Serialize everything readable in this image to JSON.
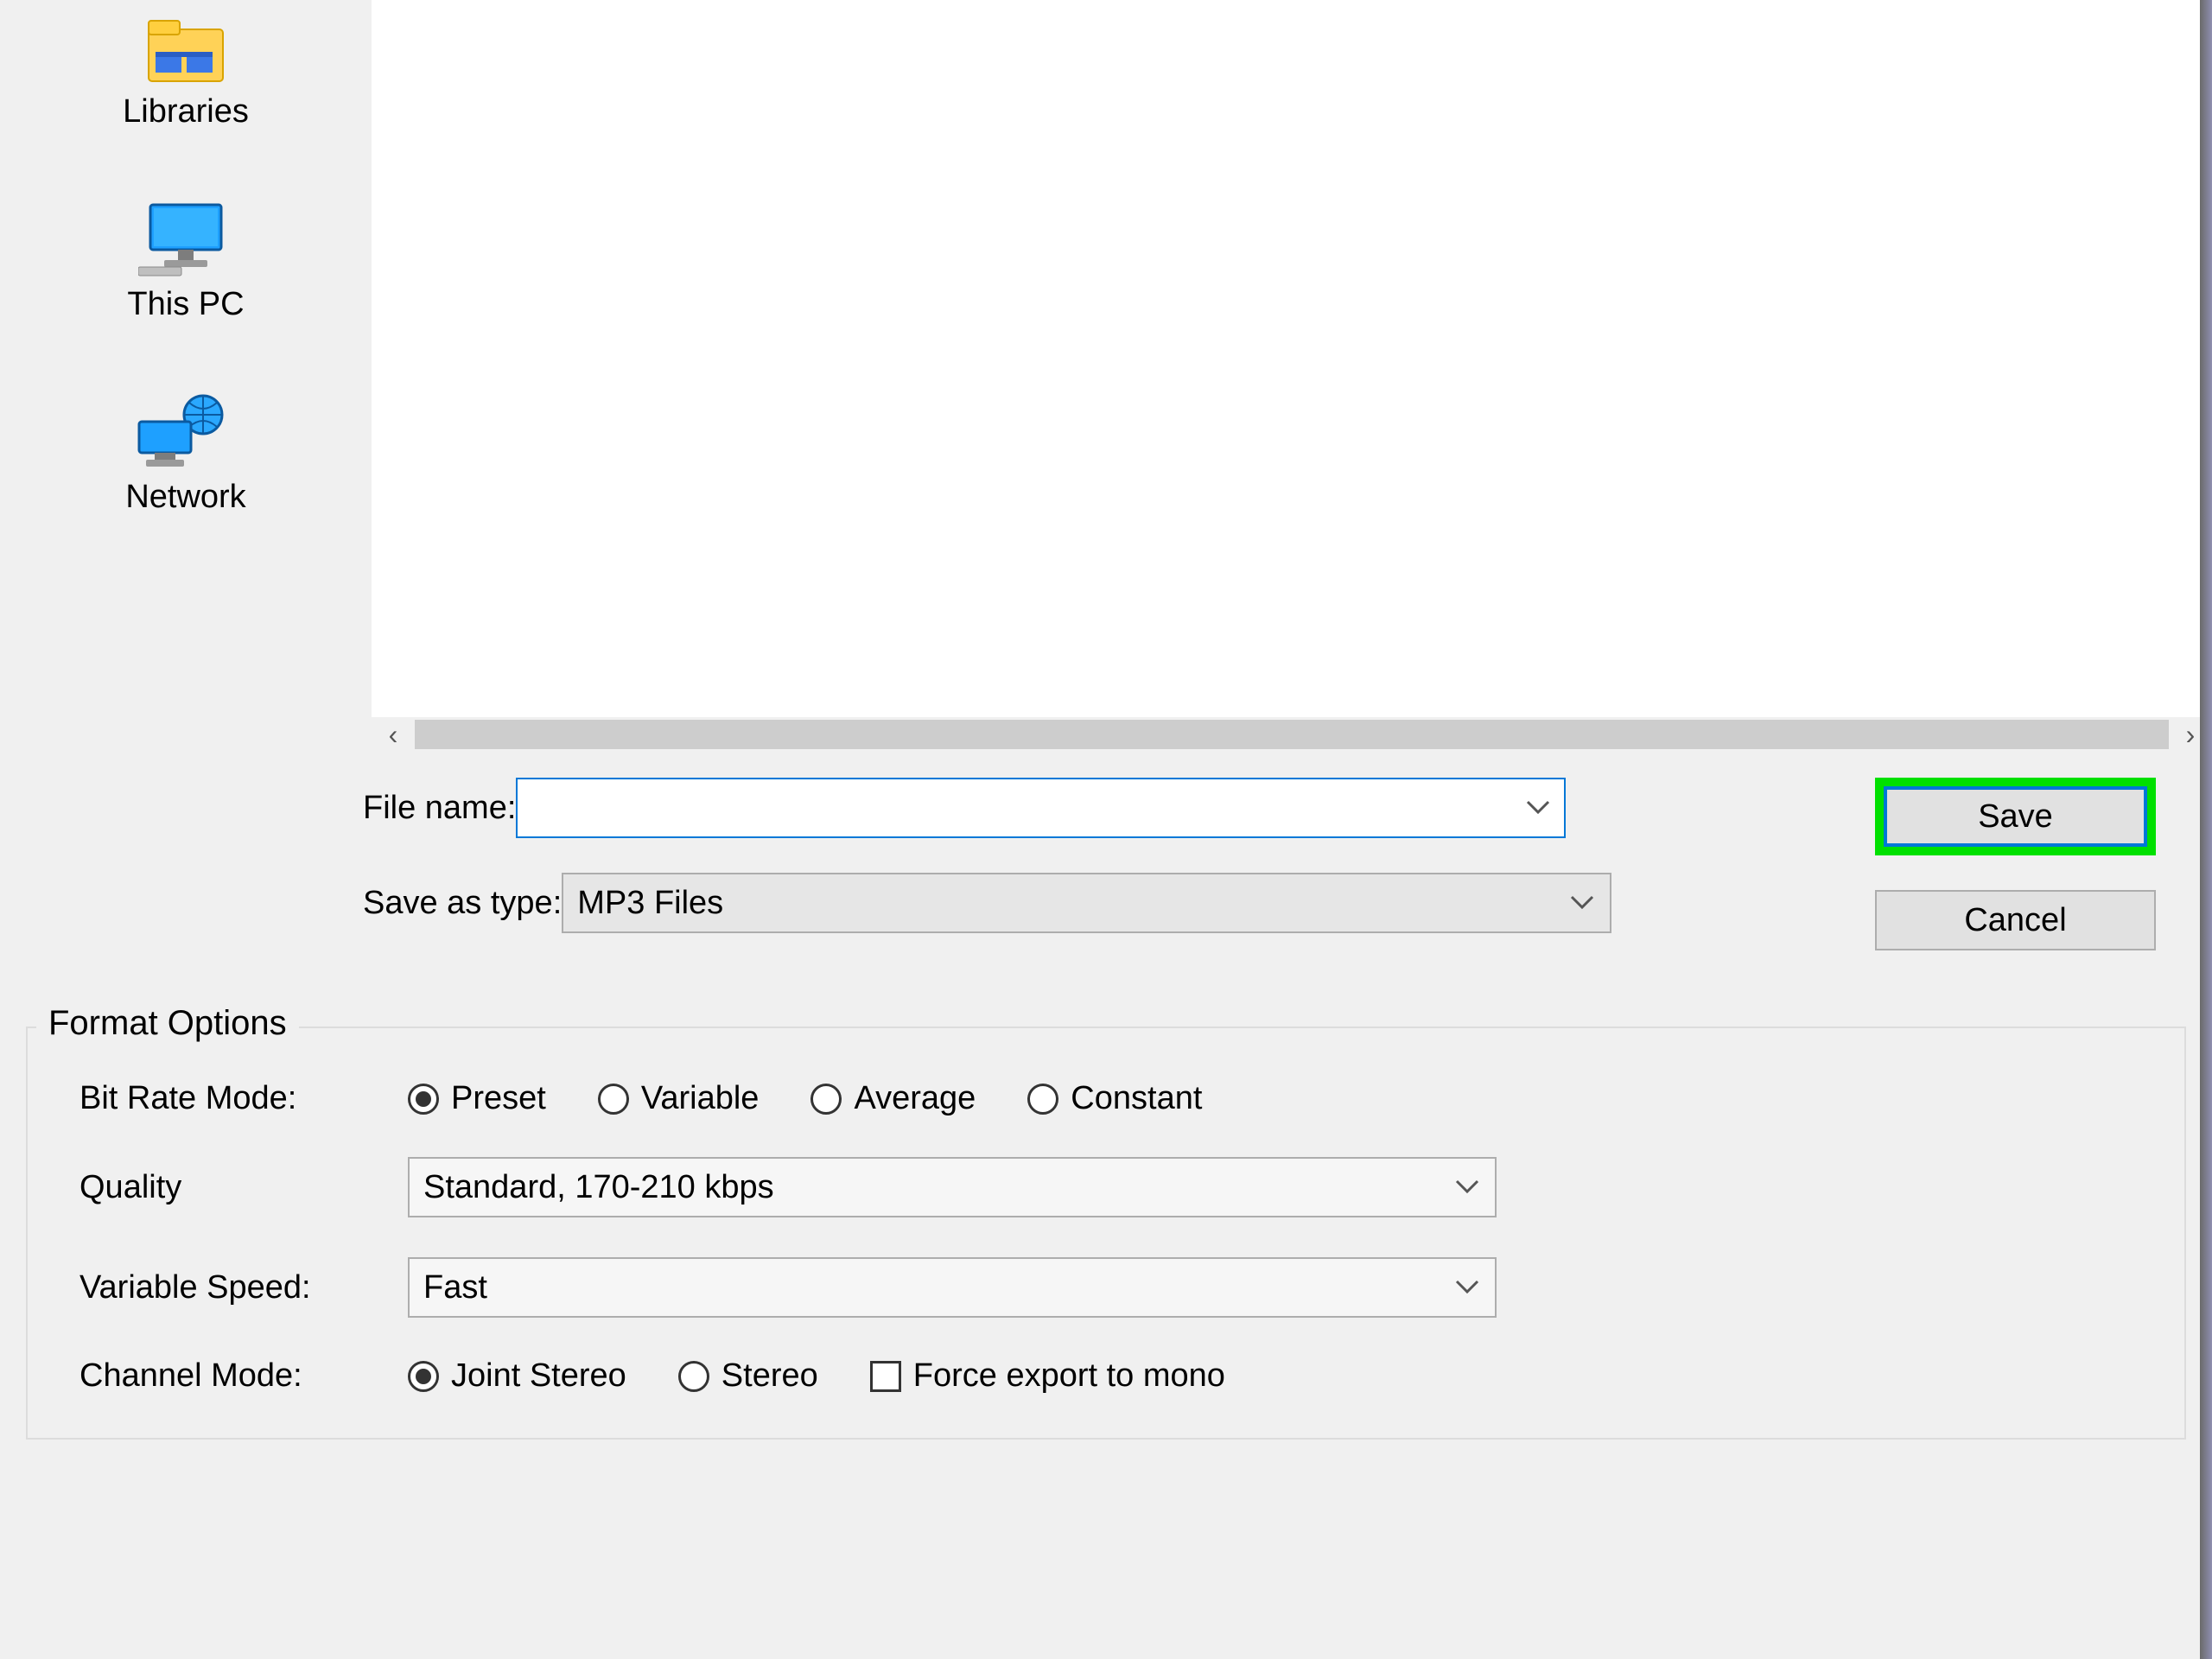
{
  "sidebar": {
    "items": [
      {
        "label": "Libraries",
        "name": "sidebar-item-libraries"
      },
      {
        "label": "This PC",
        "name": "sidebar-item-this-pc"
      },
      {
        "label": "Network",
        "name": "sidebar-item-network"
      }
    ]
  },
  "file_row": {
    "label": "File name:",
    "value": ""
  },
  "type_row": {
    "label": "Save as type:",
    "value": "MP3 Files"
  },
  "buttons": {
    "save": "Save",
    "cancel": "Cancel"
  },
  "format_options": {
    "legend": "Format Options",
    "bit_rate_mode": {
      "label": "Bit Rate Mode:",
      "options": [
        "Preset",
        "Variable",
        "Average",
        "Constant"
      ],
      "selected": "Preset"
    },
    "quality": {
      "label": "Quality",
      "value": "Standard, 170-210 kbps"
    },
    "variable_speed": {
      "label": "Variable Speed:",
      "value": "Fast"
    },
    "channel_mode": {
      "label": "Channel Mode:",
      "options": [
        "Joint Stereo",
        "Stereo"
      ],
      "selected": "Joint Stereo",
      "force_mono": {
        "label": "Force export to mono",
        "checked": false
      }
    }
  }
}
